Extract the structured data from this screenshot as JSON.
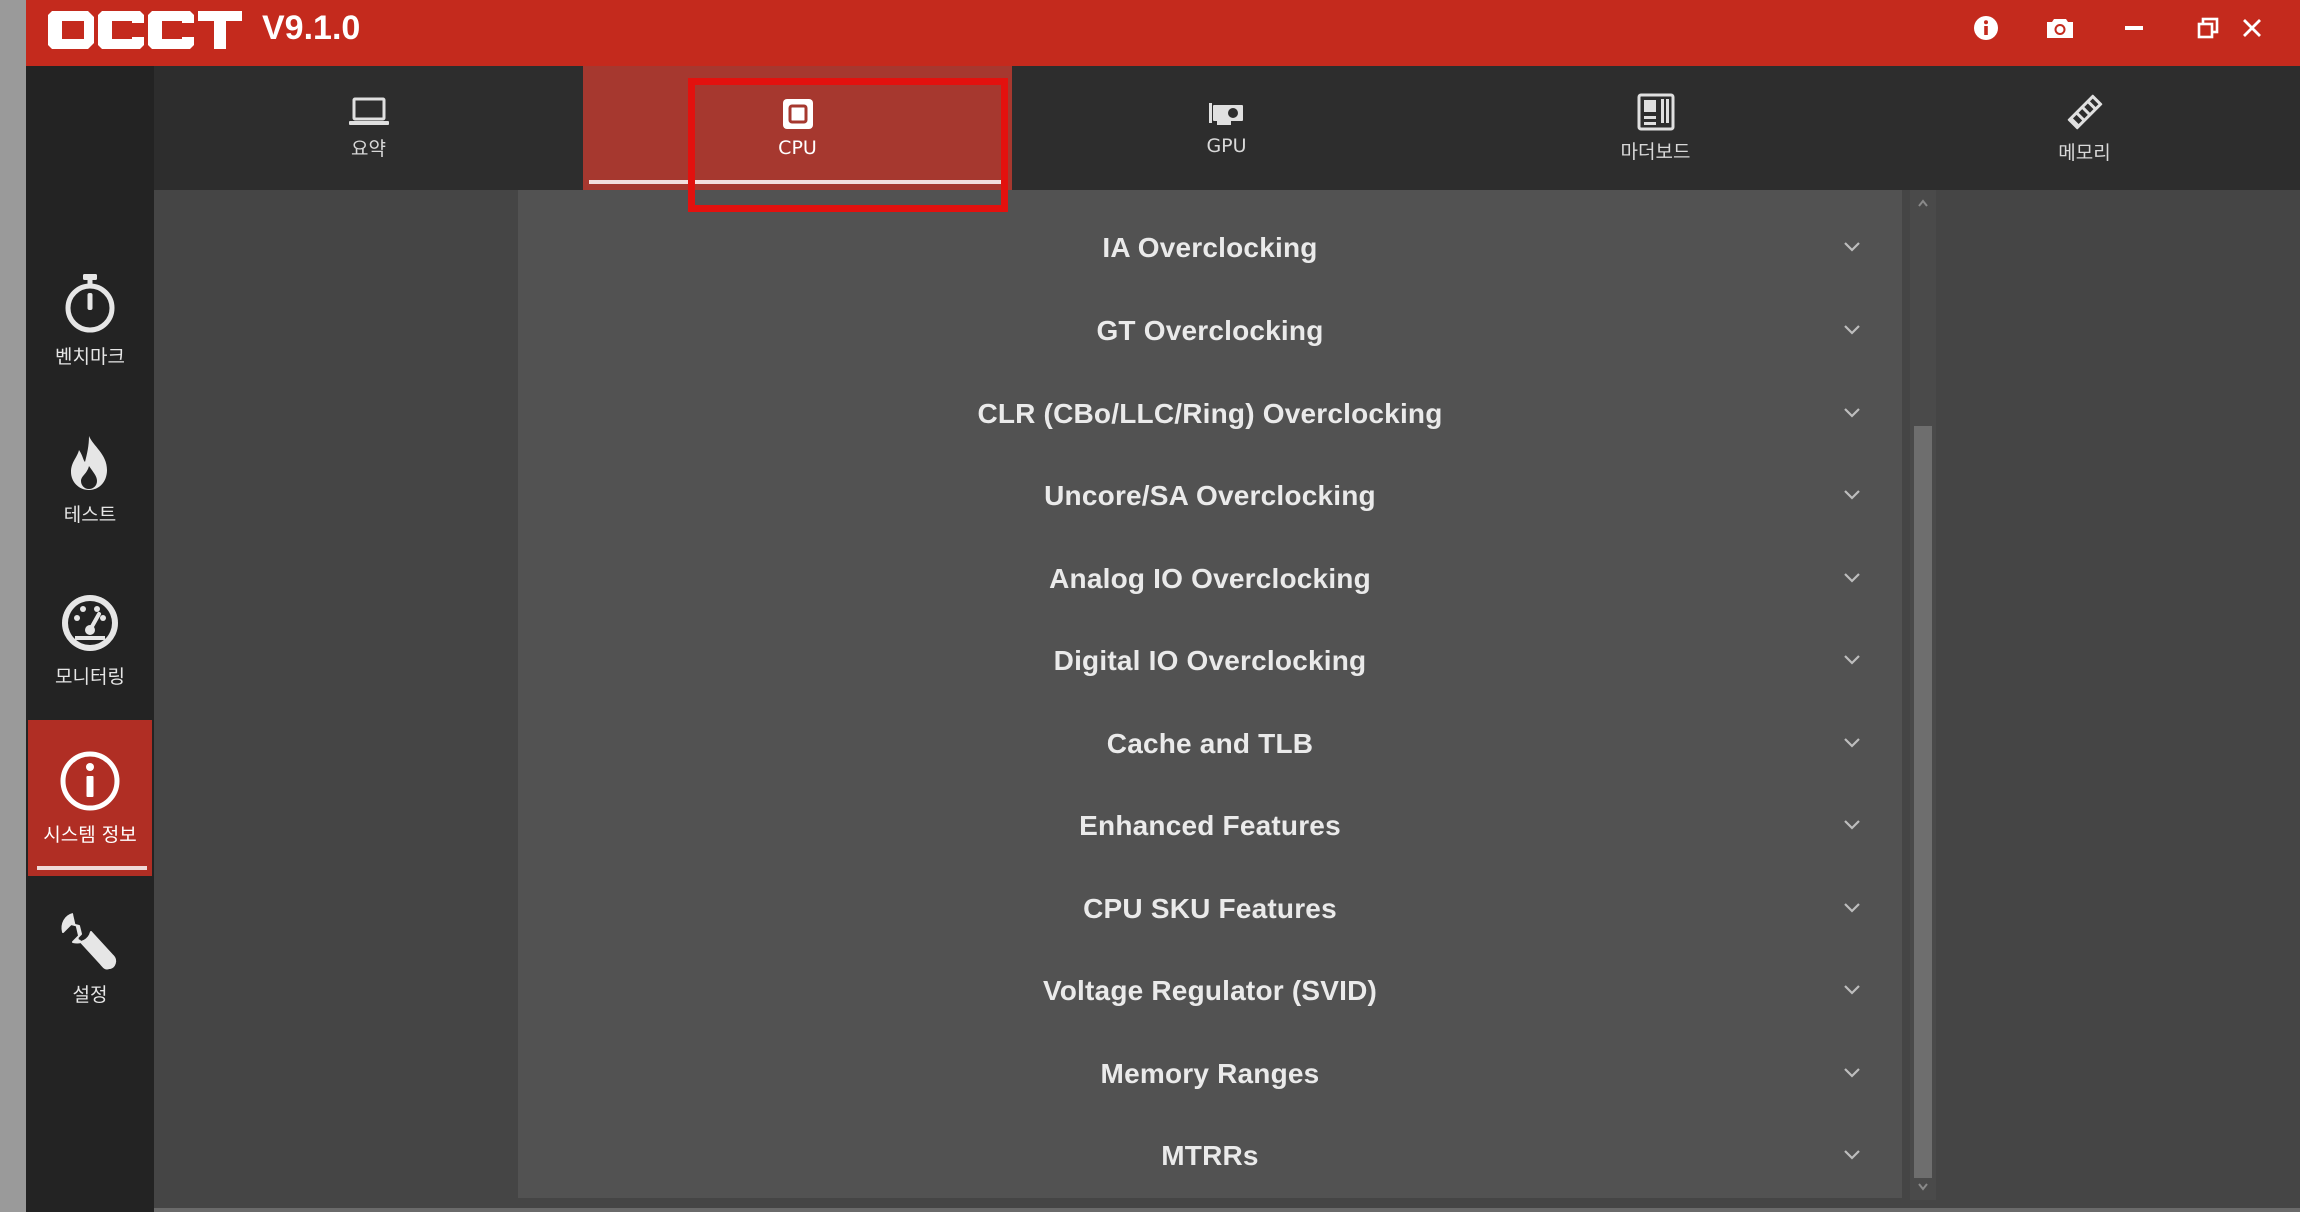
{
  "app": {
    "logo_text": "OCCT",
    "version": "V9.1.0"
  },
  "titlebar": {
    "buttons": [
      {
        "name": "info-icon"
      },
      {
        "name": "camera-icon"
      },
      {
        "name": "minimize-icon"
      },
      {
        "name": "restore-icon"
      },
      {
        "name": "close-icon"
      }
    ]
  },
  "sidebar": {
    "items": [
      {
        "label": "벤치마크",
        "icon": "stopwatch-icon"
      },
      {
        "label": "테스트",
        "icon": "flame-icon"
      },
      {
        "label": "모니터링",
        "icon": "gauge-icon"
      },
      {
        "label": "시스템 정보",
        "icon": "info-circle-icon",
        "active": true
      },
      {
        "label": "설정",
        "icon": "wrench-icon"
      }
    ]
  },
  "tabs": [
    {
      "label": "요약",
      "icon": "laptop-icon"
    },
    {
      "label": "CPU",
      "icon": "cpu-icon",
      "active": true
    },
    {
      "label": "GPU",
      "icon": "gpu-icon"
    },
    {
      "label": "마더보드",
      "icon": "motherboard-icon"
    },
    {
      "label": "메모리",
      "icon": "memory-icon"
    }
  ],
  "sections": [
    "IA Overclocking",
    "GT Overclocking",
    "CLR (CBo/LLC/Ring) Overclocking",
    "Uncore/SA Overclocking",
    "Analog IO Overclocking",
    "Digital IO Overclocking",
    "Cache and TLB",
    "Enhanced Features",
    "CPU SKU Features",
    "Voltage Regulator (SVID)",
    "Memory Ranges",
    "MTRRs"
  ],
  "colors": {
    "brand": "#c42a1d",
    "active_tab": "#a6382f",
    "active_nav": "#b02e24",
    "highlight": "#e3110e"
  }
}
